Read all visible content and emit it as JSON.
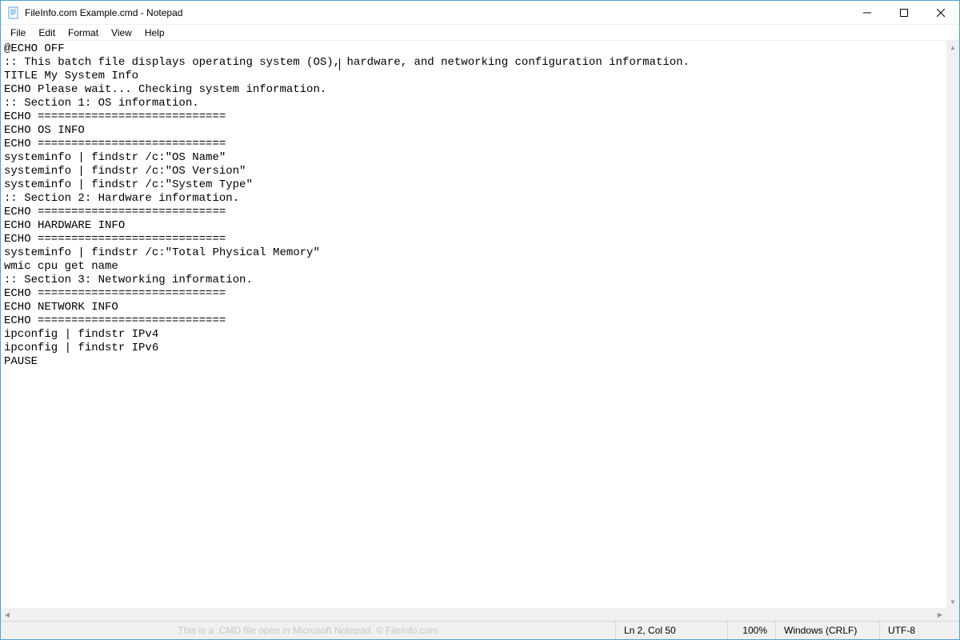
{
  "titlebar": {
    "title": "FileInfo.com Example.cmd - Notepad"
  },
  "menu": {
    "file": "File",
    "edit": "Edit",
    "format": "Format",
    "view": "View",
    "help": "Help"
  },
  "editor": {
    "lines": [
      "@ECHO OFF",
      ":: This batch file displays operating system (OS), hardware, and networking configuration information.",
      "TITLE My System Info",
      "ECHO Please wait... Checking system information.",
      ":: Section 1: OS information.",
      "ECHO ============================",
      "ECHO OS INFO",
      "ECHO ============================",
      "systeminfo | findstr /c:\"OS Name\"",
      "systeminfo | findstr /c:\"OS Version\"",
      "systeminfo | findstr /c:\"System Type\"",
      ":: Section 2: Hardware information.",
      "ECHO ============================",
      "ECHO HARDWARE INFO",
      "ECHO ============================",
      "systeminfo | findstr /c:\"Total Physical Memory\"",
      "wmic cpu get name",
      ":: Section 3: Networking information.",
      "ECHO ============================",
      "ECHO NETWORK INFO",
      "ECHO ============================",
      "ipconfig | findstr IPv4",
      "ipconfig | findstr IPv6",
      "PAUSE"
    ],
    "caret_line": 1,
    "caret_col": 50
  },
  "statusbar": {
    "watermark": "This is a .CMD file open in Microsoft Notepad. © FileInfo.com",
    "position": "Ln 2, Col 50",
    "zoom": "100%",
    "eol": "Windows (CRLF)",
    "encoding": "UTF-8"
  }
}
